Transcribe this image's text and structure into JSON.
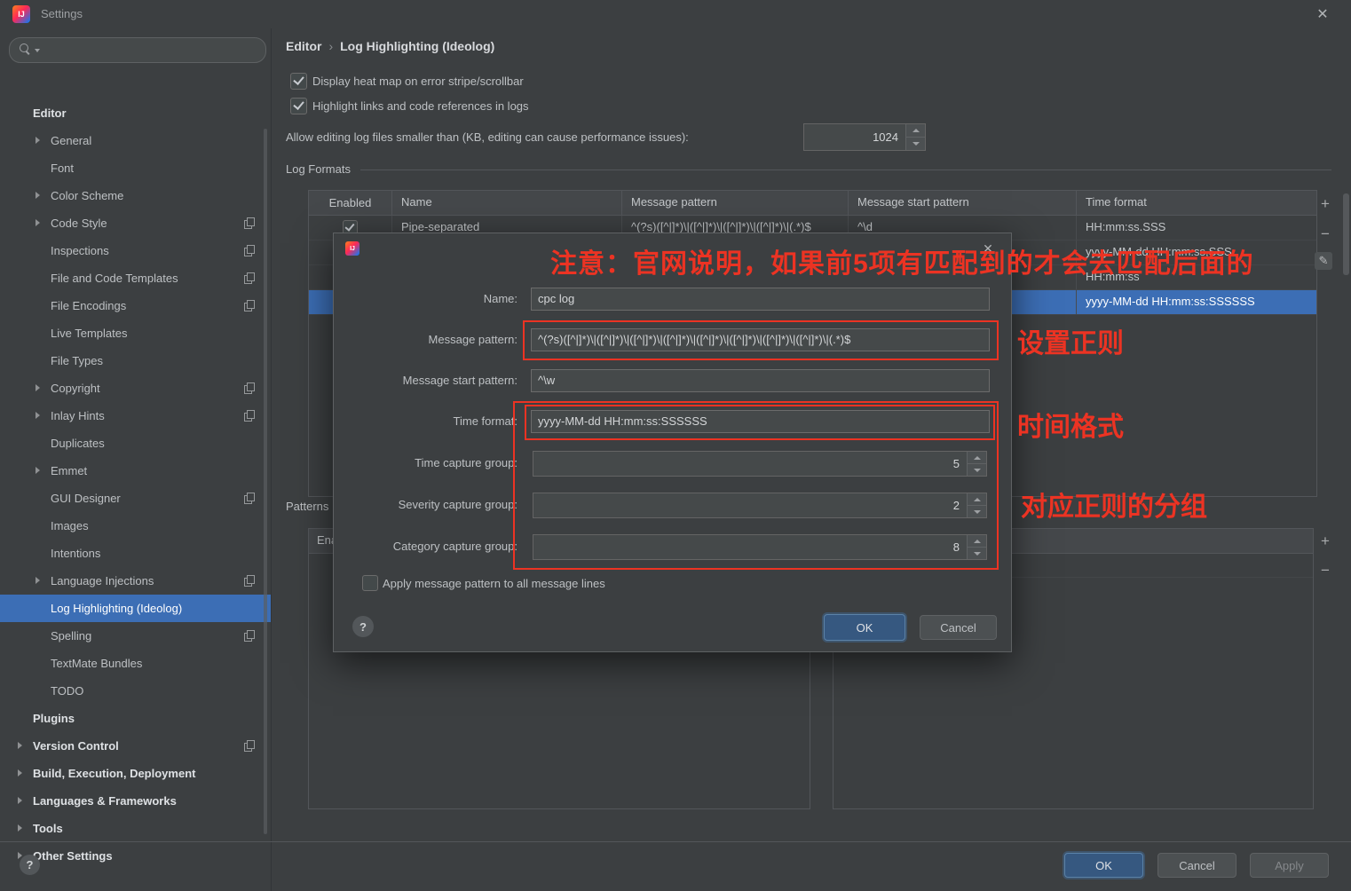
{
  "window": {
    "title": "Settings",
    "close_glyph": "✕"
  },
  "colors": {
    "annotation_red": "#ec3323",
    "selection_blue": "#3c6eb5",
    "primary_button_blue": "#365880"
  },
  "sidebar": {
    "items": [
      {
        "label": "Editor",
        "level": 0,
        "bold": true,
        "arrow": false,
        "icon": false,
        "selected": false
      },
      {
        "label": "General",
        "level": 1,
        "bold": false,
        "arrow": true,
        "icon": false,
        "selected": false
      },
      {
        "label": "Font",
        "level": 1,
        "bold": false,
        "arrow": false,
        "icon": false,
        "selected": false
      },
      {
        "label": "Color Scheme",
        "level": 1,
        "bold": false,
        "arrow": true,
        "icon": false,
        "selected": false
      },
      {
        "label": "Code Style",
        "level": 1,
        "bold": false,
        "arrow": true,
        "icon": true,
        "selected": false
      },
      {
        "label": "Inspections",
        "level": 1,
        "bold": false,
        "arrow": false,
        "icon": true,
        "selected": false
      },
      {
        "label": "File and Code Templates",
        "level": 1,
        "bold": false,
        "arrow": false,
        "icon": true,
        "selected": false
      },
      {
        "label": "File Encodings",
        "level": 1,
        "bold": false,
        "arrow": false,
        "icon": true,
        "selected": false
      },
      {
        "label": "Live Templates",
        "level": 1,
        "bold": false,
        "arrow": false,
        "icon": false,
        "selected": false
      },
      {
        "label": "File Types",
        "level": 1,
        "bold": false,
        "arrow": false,
        "icon": false,
        "selected": false
      },
      {
        "label": "Copyright",
        "level": 1,
        "bold": false,
        "arrow": true,
        "icon": true,
        "selected": false
      },
      {
        "label": "Inlay Hints",
        "level": 1,
        "bold": false,
        "arrow": true,
        "icon": true,
        "selected": false
      },
      {
        "label": "Duplicates",
        "level": 1,
        "bold": false,
        "arrow": false,
        "icon": false,
        "selected": false
      },
      {
        "label": "Emmet",
        "level": 1,
        "bold": false,
        "arrow": true,
        "icon": false,
        "selected": false
      },
      {
        "label": "GUI Designer",
        "level": 1,
        "bold": false,
        "arrow": false,
        "icon": true,
        "selected": false
      },
      {
        "label": "Images",
        "level": 1,
        "bold": false,
        "arrow": false,
        "icon": false,
        "selected": false
      },
      {
        "label": "Intentions",
        "level": 1,
        "bold": false,
        "arrow": false,
        "icon": false,
        "selected": false
      },
      {
        "label": "Language Injections",
        "level": 1,
        "bold": false,
        "arrow": true,
        "icon": true,
        "selected": false
      },
      {
        "label": "Log Highlighting (Ideolog)",
        "level": 1,
        "bold": false,
        "arrow": false,
        "icon": false,
        "selected": true
      },
      {
        "label": "Spelling",
        "level": 1,
        "bold": false,
        "arrow": false,
        "icon": true,
        "selected": false
      },
      {
        "label": "TextMate Bundles",
        "level": 1,
        "bold": false,
        "arrow": false,
        "icon": false,
        "selected": false
      },
      {
        "label": "TODO",
        "level": 1,
        "bold": false,
        "arrow": false,
        "icon": false,
        "selected": false
      },
      {
        "label": "Plugins",
        "level": 0,
        "bold": true,
        "arrow": false,
        "icon": false,
        "selected": false
      },
      {
        "label": "Version Control",
        "level": 0,
        "bold": true,
        "arrow": true,
        "icon": true,
        "selected": false
      },
      {
        "label": "Build, Execution, Deployment",
        "level": 0,
        "bold": true,
        "arrow": true,
        "icon": false,
        "selected": false
      },
      {
        "label": "Languages & Frameworks",
        "level": 0,
        "bold": true,
        "arrow": true,
        "icon": false,
        "selected": false
      },
      {
        "label": "Tools",
        "level": 0,
        "bold": true,
        "arrow": true,
        "icon": false,
        "selected": false
      },
      {
        "label": "Other Settings",
        "level": 0,
        "bold": true,
        "arrow": true,
        "icon": false,
        "selected": false
      }
    ]
  },
  "main": {
    "breadcrumb": {
      "section": "Editor",
      "separator": "›",
      "page": "Log Highlighting (Ideolog)"
    },
    "checkbox_heatmap_label": "Display heat map on error stripe/scrollbar",
    "checkbox_links_label": "Highlight links and code references in logs",
    "allow_editing_label": "Allow editing log files smaller than (KB, editing can cause performance issues):",
    "allow_editing_value": "1024",
    "log_formats_label": "Log Formats",
    "table": {
      "headers": [
        "Enabled",
        "Name",
        "Message pattern",
        "Message start pattern",
        "Time format"
      ],
      "rows": [
        {
          "enabled": true,
          "name": "Pipe-separated",
          "message_pattern": "^(?s)([^|]*)\\|([^|]*)\\|([^|]*)\\|([^|]*)\\|(.*)$",
          "message_start_pattern": "^\\d",
          "time_format": "HH:mm:ss.SSS",
          "selected": false
        },
        {
          "enabled": false,
          "name": "",
          "message_pattern": "",
          "message_start_pattern": "",
          "time_format": "yyyy-MM-dd HH:mm:ss,SSS",
          "selected": false
        },
        {
          "enabled": false,
          "name": "",
          "message_pattern": "",
          "message_start_pattern": "",
          "time_format": "HH:mm:ss",
          "selected": false
        },
        {
          "enabled": false,
          "name": "",
          "message_pattern": "",
          "message_start_pattern": "",
          "time_format": "yyyy-MM-dd HH:mm:ss:SSSSSS",
          "selected": true
        }
      ]
    },
    "patterns_label": "Patterns",
    "patterns_table_header": "Enabled",
    "buttons": {
      "ok": "OK",
      "cancel": "Cancel",
      "apply": "Apply"
    },
    "help_label": "?"
  },
  "dialog": {
    "close_glyph": "✕",
    "fields": {
      "name_label": "Name:",
      "name_value": "cpc log",
      "message_pattern_label": "Message pattern:",
      "message_pattern_value": "^(?s)([^|]*)\\|([^|]*)\\|([^|]*)\\|([^|]*)\\|([^|]*)\\|([^|]*)\\|([^|]*)\\|([^|]*)\\|(.*)$",
      "message_start_label": "Message start pattern:",
      "message_start_value": "^\\w",
      "time_format_label": "Time format:",
      "time_format_value": "yyyy-MM-dd HH:mm:ss:SSSSSS",
      "time_capture_label": "Time capture group:",
      "time_capture_value": "5",
      "severity_capture_label": "Severity capture group:",
      "severity_capture_value": "2",
      "category_capture_label": "Category capture group:",
      "category_capture_value": "8",
      "apply_all_label": "Apply message pattern to all message lines"
    },
    "buttons": {
      "ok": "OK",
      "cancel": "Cancel"
    },
    "help_label": "?"
  },
  "annotations": {
    "top_note": "注意：官网说明，如果前5项有匹配到的才会去匹配后面的",
    "regex_note": "设置正则",
    "time_note": "时间格式",
    "group_note": "对应正则的分组"
  }
}
